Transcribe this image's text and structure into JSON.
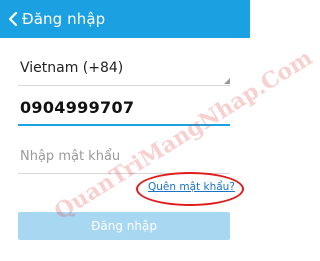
{
  "header": {
    "title": "Đăng nhập",
    "back_icon": "chevron-left-icon",
    "background_color": "#1ba0e2"
  },
  "form": {
    "country_value": "Vietnam (+84)",
    "phone_value": "0904999707",
    "password_placeholder": "Nhập mật khẩu",
    "forgot_password_label": "Quên mật khẩu?",
    "login_button_label": "Đăng nhập"
  },
  "watermark": {
    "text": "QuanTriMangNhap.Com"
  },
  "colors": {
    "accent": "#1ba0e2",
    "link": "#1a73c7",
    "highlight_circle": "#e11a1a",
    "disabled_button": "#a8d7f2"
  }
}
